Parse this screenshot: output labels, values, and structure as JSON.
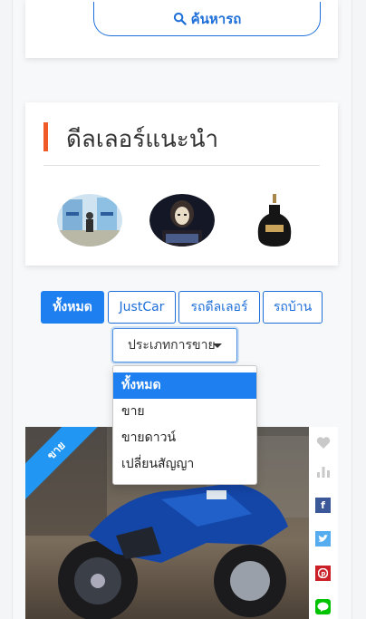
{
  "search": {
    "button_label": "ค้นหารถ"
  },
  "dealers": {
    "title": "ดีลเลอร์แนะนำ",
    "avatars": [
      "dealer-avatar-1",
      "dealer-avatar-2",
      "dealer-avatar-3"
    ]
  },
  "filter_tabs": [
    {
      "label": "ทั้งหมด",
      "active": true
    },
    {
      "label": "JustCar",
      "active": false
    },
    {
      "label": "รถดีลเลอร์",
      "active": false
    },
    {
      "label": "รถบ้าน",
      "active": false
    }
  ],
  "sale_type_select": {
    "value": "ประเภทการขาย",
    "options": [
      "ทั้งหมด",
      "ขาย",
      "ขายดาวน์",
      "เปลี่ยนสัญญา"
    ],
    "selected_option": "ทั้งหมด"
  },
  "listing": {
    "ribbon": "ขาย"
  },
  "social_icons": [
    "heart-icon",
    "stats-icon",
    "facebook-icon",
    "twitter-icon",
    "pinterest-icon",
    "line-icon"
  ],
  "colors": {
    "primary": "#1e7ff0",
    "accent": "#f05a28",
    "facebook": "#3b5998",
    "twitter": "#55acee",
    "pinterest": "#cb2027",
    "line": "#00c300"
  }
}
